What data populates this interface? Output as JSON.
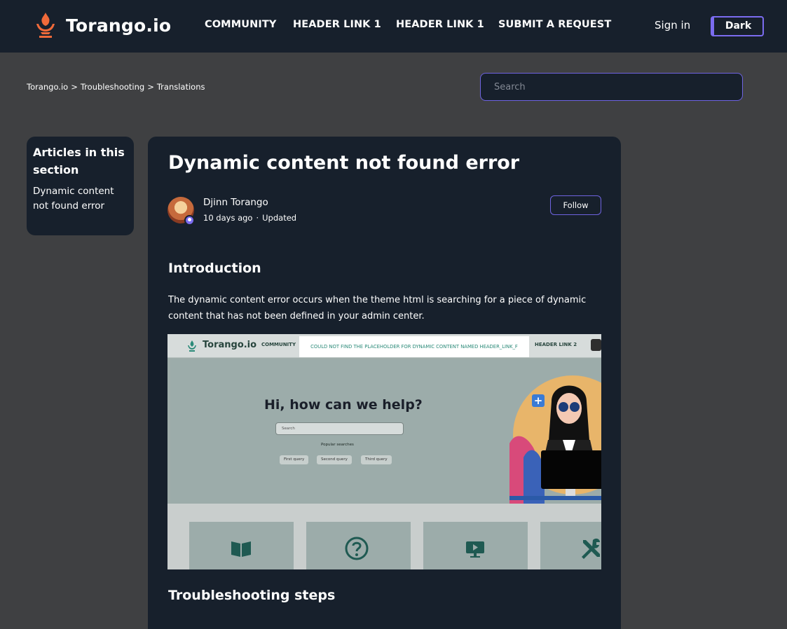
{
  "header": {
    "brand": "Torango.io",
    "nav": [
      "COMMUNITY",
      "HEADER LINK 1",
      "HEADER LINK 1",
      "SUBMIT A REQUEST"
    ],
    "signin": "Sign in",
    "theme_toggle": "Dark"
  },
  "breadcrumb": [
    "Torango.io",
    "Troubleshooting",
    "Translations"
  ],
  "breadcrumb_separator": ">",
  "search": {
    "placeholder": "Search"
  },
  "sidebar": {
    "title": "Articles in this section",
    "items": [
      "Dynamic content not found error"
    ]
  },
  "article": {
    "title": "Dynamic content not found error",
    "author": "Djinn Torango",
    "time": "10 days ago",
    "meta_separator": "·",
    "updated": "Updated",
    "follow_label": "Follow",
    "intro_heading": "Introduction",
    "intro_text": "The dynamic content error occurs when the theme html is searching for a piece of dynamic content that has not been defined in your admin center.",
    "steps_heading": "Troubleshooting steps"
  },
  "screenshot": {
    "brand": "Torango.io",
    "nav_community": "COMMUNITY",
    "error_text": "COULD NOT FIND THE PLACEHOLDER FOR DYNAMIC CONTENT NAMED HEADER_LINK_F",
    "nav_header2": "HEADER LINK 2",
    "hero_heading": "Hi, how can we help?",
    "search_placeholder": "Search",
    "popular_label": "Popular searches",
    "queries": [
      "First query",
      "Second query",
      "Third query"
    ],
    "plus": "+"
  },
  "colors": {
    "header_bg": "#17202c",
    "page_bg": "#3f4042",
    "accent": "#7b6cf0",
    "logo": "#f06a3a"
  }
}
